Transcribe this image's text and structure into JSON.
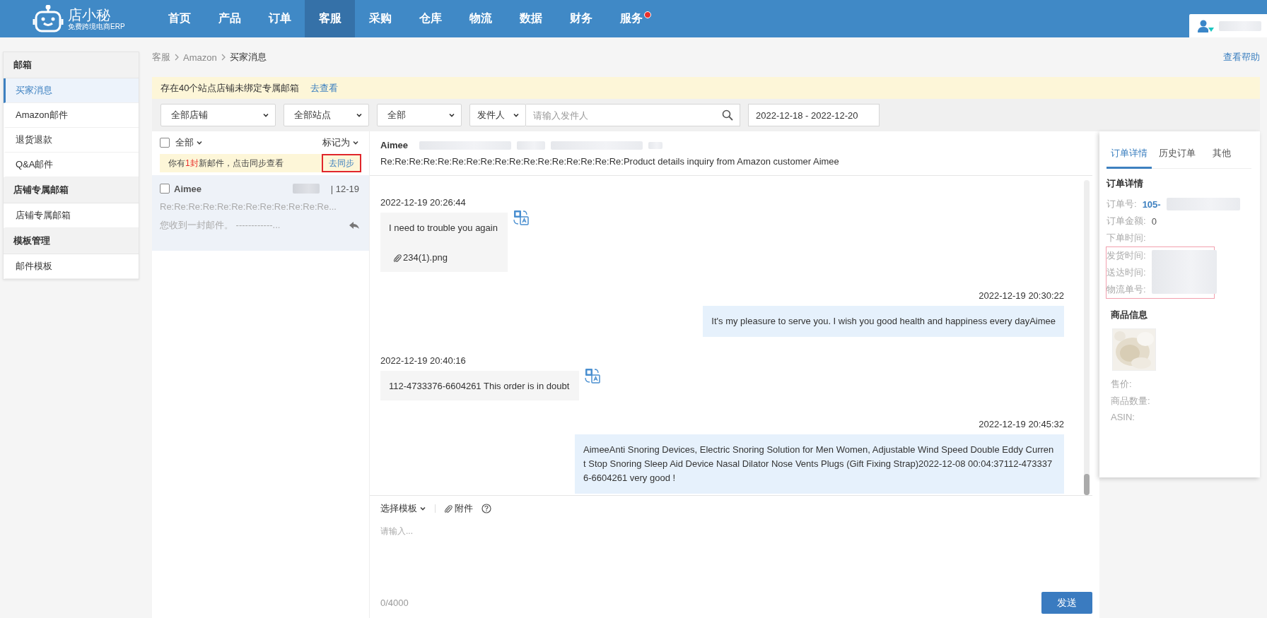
{
  "header": {
    "logo": {
      "name": "店小秘",
      "tagline": "免费跨境电商ERP"
    },
    "nav": [
      {
        "label": "首页",
        "selected": false,
        "badge": false
      },
      {
        "label": "产品",
        "selected": false,
        "badge": false
      },
      {
        "label": "订单",
        "selected": false,
        "badge": false
      },
      {
        "label": "客服",
        "selected": true,
        "badge": false
      },
      {
        "label": "采购",
        "selected": false,
        "badge": false
      },
      {
        "label": "仓库",
        "selected": false,
        "badge": false
      },
      {
        "label": "物流",
        "selected": false,
        "badge": false
      },
      {
        "label": "数据",
        "selected": false,
        "badge": false
      },
      {
        "label": "财务",
        "selected": false,
        "badge": false
      },
      {
        "label": "服务",
        "selected": false,
        "badge": true
      }
    ]
  },
  "sidebar": {
    "sections": [
      {
        "title": "邮箱",
        "items": [
          {
            "label": "买家消息",
            "selected": true
          },
          {
            "label": "Amazon邮件",
            "selected": false
          },
          {
            "label": "退货退款",
            "selected": false
          },
          {
            "label": "Q&A邮件",
            "selected": false
          }
        ]
      },
      {
        "title": "店铺专属邮箱",
        "items": [
          {
            "label": "店铺专属邮箱",
            "selected": false
          }
        ]
      },
      {
        "title": "模板管理",
        "items": [
          {
            "label": "邮件模板",
            "selected": false
          }
        ]
      }
    ]
  },
  "breadcrumb": [
    "客服",
    "Amazon",
    "买家消息"
  ],
  "help_link": "查看帮助",
  "notice": {
    "text": "存在40个站点店铺未绑定专属邮箱",
    "link": "去查看"
  },
  "filters": {
    "selects": [
      "全部店铺",
      "全部站点",
      "全部"
    ],
    "sender_select": "发件人",
    "sender_placeholder": "请输入发件人",
    "date_range": "2022-12-18 - 2022-12-20"
  },
  "message_list": {
    "select_all": {
      "label": "全部",
      "checked": false
    },
    "mark_as": "标记为",
    "sync_notice": {
      "before": "你有",
      "count": "1封",
      "after": "新邮件，点击同步查看",
      "button": "去同步"
    },
    "items": [
      {
        "sender": "Aimee",
        "date": "| 12-19",
        "subject": "Re:Re:Re:Re:Re:Re:Re:Re:Re:Re:Re:Re...",
        "preview": "您收到一封邮件。 ------------...",
        "checked": false,
        "selected": true,
        "replied": true
      }
    ]
  },
  "conversation": {
    "sender": "Aimee",
    "subject": "Re:Re:Re:Re:Re:Re:Re:Re:Re:Re:Re:Re:Re:Re:Re:Re:Re:Product details inquiry from Amazon customer Aimee",
    "messages": [
      {
        "kind": "received",
        "time": "2022-12-19 20:26:44",
        "text": "I need to trouble you again",
        "attachment": "234(1).png"
      },
      {
        "kind": "sent",
        "time": "2022-12-19 20:30:22",
        "text": "It's my pleasure to serve you. I wish you good health and happiness every dayAimee"
      },
      {
        "kind": "received",
        "time": "2022-12-19 20:40:16",
        "text": "112-4733376-6604261  This order is in doubt"
      },
      {
        "kind": "sent",
        "time": "2022-12-19 20:45:32",
        "text": "AimeeAnti Snoring Devices, Electric Snoring Solution for Men Women, Adjustable Wind Speed Double Eddy Current Stop Snoring Sleep Aid Device Nasal Dilator Nose Vents Plugs (Gift Fixing Strap)2022-12-08 00:04:37112-4733376-6604261   very  good !"
      }
    ]
  },
  "composer": {
    "template": "选择模板",
    "attachment": "附件",
    "placeholder": "请输入...",
    "counter": "0/4000",
    "send": "发送"
  },
  "order_panel": {
    "tabs": [
      {
        "label": "订单详情",
        "selected": true
      },
      {
        "label": "历史订单",
        "selected": false
      },
      {
        "label": "其他",
        "selected": false
      }
    ],
    "title": "订单详情",
    "order_number": {
      "label": "订单号:",
      "value": "105-"
    },
    "fields": [
      {
        "label": "订单金额:",
        "value": "0"
      },
      {
        "label": "下单时间:"
      }
    ],
    "highlighted_fields": [
      "发货时间:",
      "送达时间:",
      "物流单号:"
    ],
    "product_title": "商品信息",
    "product_fields": [
      "售价:",
      "商品数量:",
      "ASIN:"
    ]
  }
}
